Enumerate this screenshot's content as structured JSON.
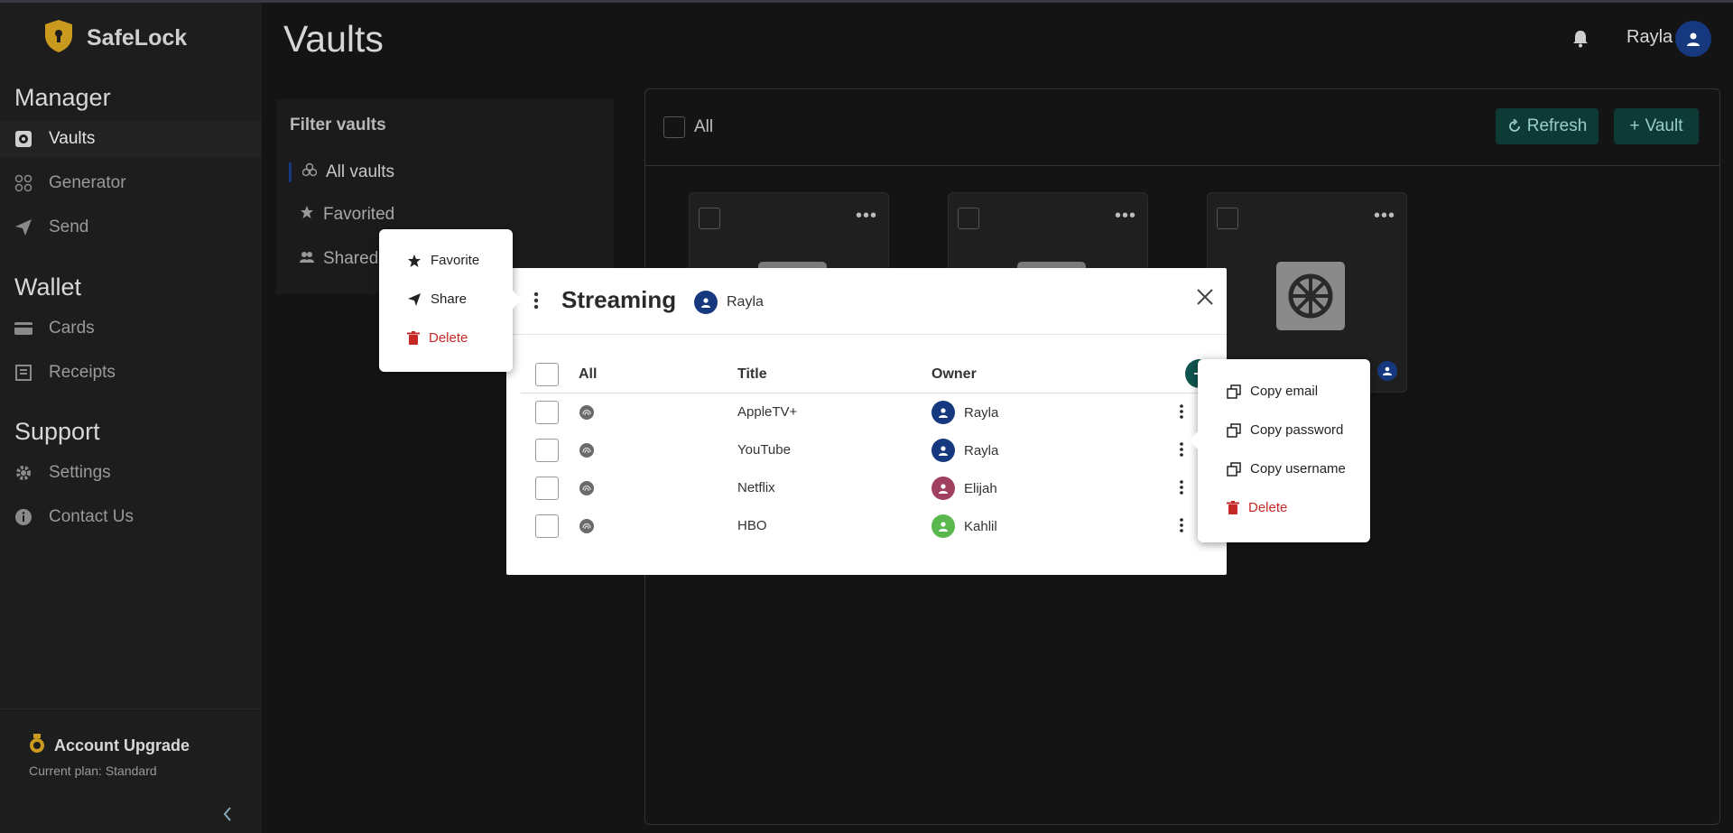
{
  "app": {
    "name": "SafeLock"
  },
  "sidebar": {
    "sections": [
      {
        "title": "Manager"
      },
      {
        "title": "Wallet"
      },
      {
        "title": "Support"
      }
    ],
    "items": [
      {
        "label": "Vaults",
        "icon": "vault-icon"
      },
      {
        "label": "Generator",
        "icon": "grid-icon"
      },
      {
        "label": "Send",
        "icon": "paper-plane-icon"
      },
      {
        "label": "Cards",
        "icon": "card-icon"
      },
      {
        "label": "Receipts",
        "icon": "receipt-icon"
      },
      {
        "label": "Settings",
        "icon": "gear-icon"
      },
      {
        "label": "Contact Us",
        "icon": "info-icon"
      }
    ],
    "upgrade": {
      "title": "Account Upgrade",
      "plan": "Current plan: Standard"
    }
  },
  "header": {
    "title": "Vaults",
    "user": "Rayla"
  },
  "filter": {
    "title": "Filter vaults",
    "items": [
      {
        "label": "All vaults"
      },
      {
        "label": "Favorited"
      },
      {
        "label": "Shared"
      }
    ]
  },
  "toolbar": {
    "all_label": "All",
    "refresh_label": "Refresh",
    "vault_label": "Vault"
  },
  "modal": {
    "title": "Streaming",
    "owner": "Rayla",
    "columns": {
      "all": "All",
      "title": "Title",
      "owner": "Owner"
    },
    "rows": [
      {
        "title": "AppleTV+",
        "owner": "Rayla",
        "owner_color": "#15387e"
      },
      {
        "title": "YouTube",
        "owner": "Rayla",
        "owner_color": "#15387e"
      },
      {
        "title": "Netflix",
        "owner": "Elijah",
        "owner_color": "#a0405e"
      },
      {
        "title": "HBO",
        "owner": "Kahlil",
        "owner_color": "#5bb84e"
      }
    ]
  },
  "vault_menu": {
    "favorite": "Favorite",
    "share": "Share",
    "delete": "Delete"
  },
  "item_menu": {
    "copy_email": "Copy email",
    "copy_password": "Copy password",
    "copy_username": "Copy username",
    "delete": "Delete"
  },
  "colors": {
    "accent": "#0f5550",
    "user": "#15387e",
    "danger": "#c62828"
  }
}
